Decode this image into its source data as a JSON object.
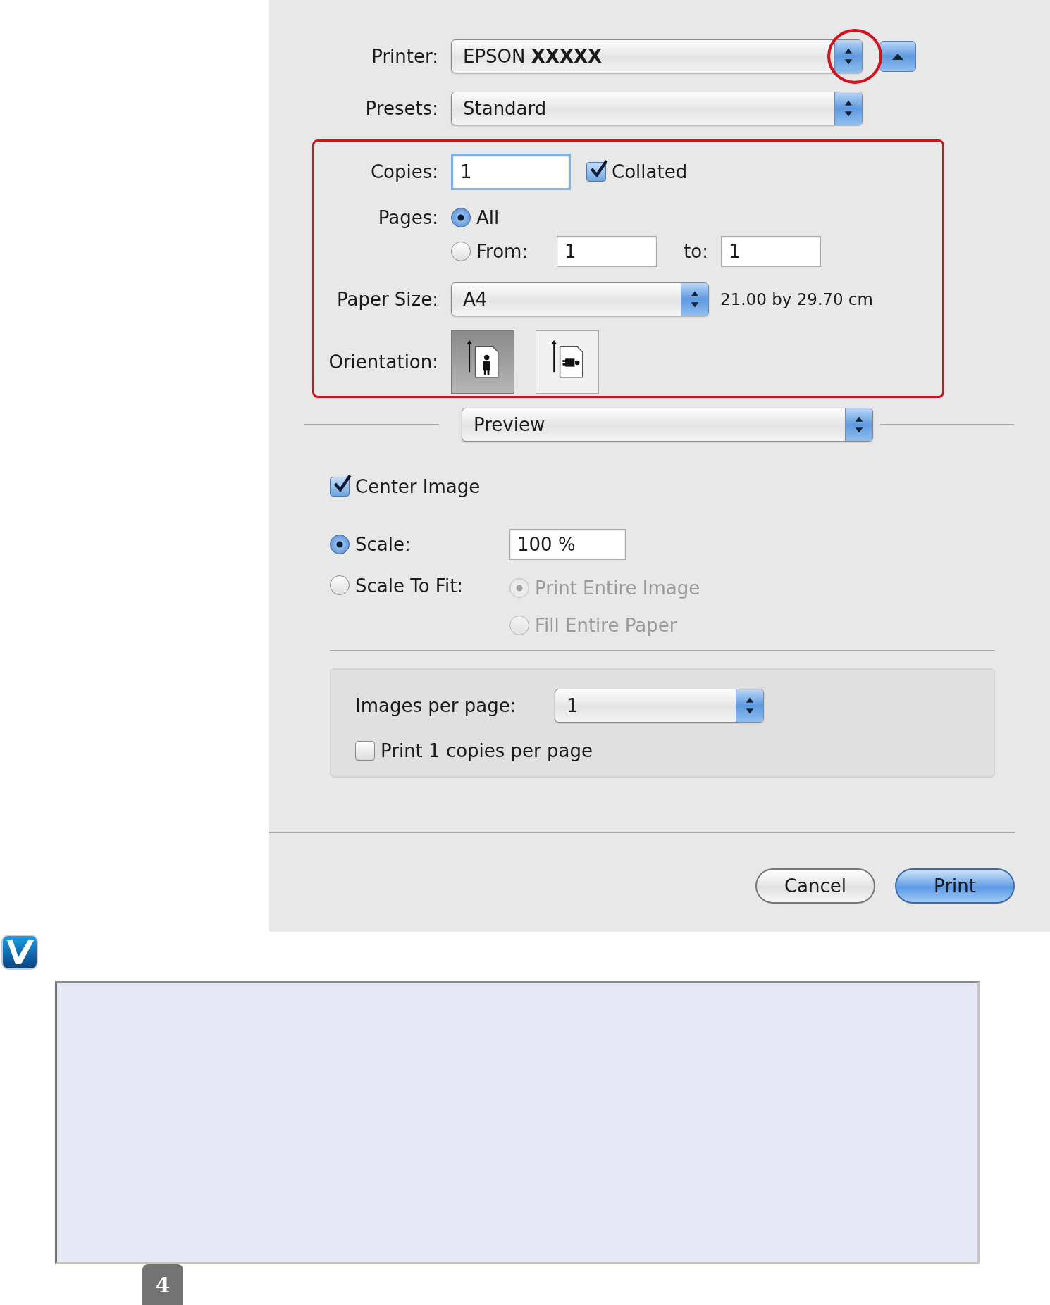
{
  "dialog": {
    "printer": {
      "label": "Printer:",
      "value": "EPSON **XXXXX**"
    },
    "presets": {
      "label": "Presets:",
      "value": "Standard"
    },
    "copies": {
      "label": "Copies:",
      "value": "1"
    },
    "collated": {
      "label": "Collated",
      "checked": true
    },
    "pages": {
      "label": "Pages:",
      "options": [
        {
          "label": "All",
          "selected": true
        },
        {
          "label": "From:",
          "selected": false
        }
      ],
      "from": "1",
      "to_label": "to:",
      "to": "1"
    },
    "paper_size": {
      "label": "Paper Size:",
      "value": "A4",
      "dimensions": "21.00 by 29.70 cm"
    },
    "orientation": {
      "label": "Orientation:",
      "options": [
        {
          "kind": "portrait",
          "selected": true
        },
        {
          "kind": "landscape",
          "selected": false
        }
      ]
    },
    "panel_menu": {
      "value": "Preview"
    },
    "center_image": {
      "label": "Center Image",
      "checked": true
    },
    "scale_options": [
      {
        "label": "Scale:",
        "selected": true
      },
      {
        "label": "Scale To Fit:",
        "selected": false
      }
    ],
    "scale_value": "100 %",
    "fit_options": [
      {
        "label": "Print Entire Image",
        "selected": true,
        "disabled": true
      },
      {
        "label": "Fill Entire Paper",
        "selected": false,
        "disabled": true
      }
    ],
    "images_per_page": {
      "label": "Images per page:",
      "value": "1"
    },
    "copies_per_page": {
      "label": "Print 1 copies per page",
      "checked": false
    },
    "buttons": [
      {
        "label": "Cancel",
        "default": false
      },
      {
        "label": "Print",
        "default": true
      }
    ]
  },
  "page_number": "4"
}
